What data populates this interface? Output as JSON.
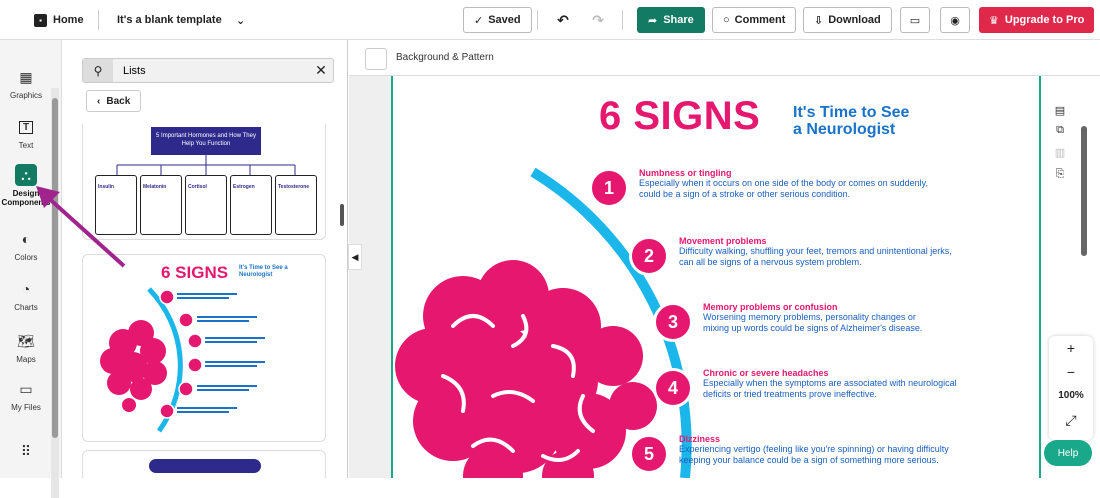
{
  "topbar": {
    "home_label": "Home",
    "doc_title": "It's a blank template",
    "saved_label": "Saved",
    "share_label": "Share",
    "comment_label": "Comment",
    "download_label": "Download",
    "upgrade_label": "Upgrade to Pro"
  },
  "rail": {
    "items": [
      {
        "label": "Graphics",
        "icon": "graphics-icon"
      },
      {
        "label": "Text",
        "icon": "text-icon"
      },
      {
        "label": "Design Components",
        "icon": "design-components-icon",
        "active": true
      },
      {
        "label": "Colors",
        "icon": "palette-icon"
      },
      {
        "label": "Charts",
        "icon": "chart-icon"
      },
      {
        "label": "Maps",
        "icon": "map-icon"
      },
      {
        "label": "My Files",
        "icon": "folder-icon"
      }
    ]
  },
  "panel": {
    "search_value": "Lists",
    "back_label": "Back",
    "thumbnail_1_title": "5 Important Hormones and How They Help You Function",
    "thumbnail_1_items": [
      "Insulin",
      "Melatonin",
      "Cortisol",
      "Estrogen",
      "Testosterone"
    ],
    "thumbnail_2_title": "6 SIGNS",
    "thumbnail_2_subtitle": "It's Time to See a Neurologist"
  },
  "canvas": {
    "page_settings_label": "Background & Pattern",
    "zoom_level": "100%",
    "help_label": "Help"
  },
  "infographic": {
    "title": "6 SIGNS",
    "subtitle_line1": "It's Time to See",
    "subtitle_line2": "a Neurologist",
    "signs": [
      {
        "number": "1",
        "heading": "Numbness or tingling",
        "line1": "Especially when it occurs on one side of the body or comes on suddenly,",
        "line2": "could be a sign of a stroke or other serious condition."
      },
      {
        "number": "2",
        "heading": "Movement problems",
        "line1": "Difficulty walking, shuffling your feet, tremors and unintentional jerks,",
        "line2": "can all be signs of a nervous system problem."
      },
      {
        "number": "3",
        "heading": "Memory problems or confusion",
        "line1": "Worsening memory problems, personality changes or",
        "line2": "mixing up words could be signs of Alzheimer's disease."
      },
      {
        "number": "4",
        "heading": "Chronic or severe headaches",
        "line1": "Especially when the symptoms are associated with neurological",
        "line2": "deficits or tried treatments prove ineffective."
      },
      {
        "number": "5",
        "heading": "Dizziness",
        "line1": "Experiencing vertigo (feeling like you're spinning) or having difficulty",
        "line2": "keeping your balance could be a sign of something more serious."
      }
    ]
  },
  "colors": {
    "brand_green": "#137a63",
    "upgrade_red": "#e0294a",
    "sign_pink": "#e5176f",
    "sign_blue": "#1a73c8",
    "arc_cyan": "#1bb6ea"
  }
}
